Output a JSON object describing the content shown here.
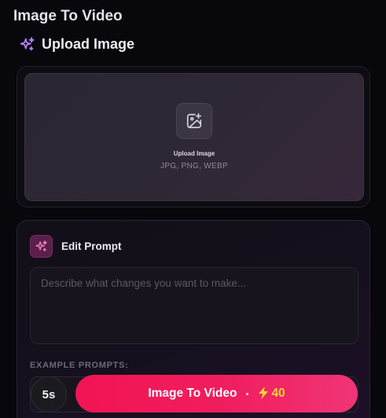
{
  "page": {
    "title": "Image To Video"
  },
  "upload_section": {
    "heading": "Upload Image",
    "heading_icon": "sparkles-icon",
    "dropzone": {
      "icon": "image-plus-icon",
      "title": "Upload Image",
      "formats": "JPG, PNG, WEBP"
    }
  },
  "prompt_section": {
    "heading": "Edit Prompt",
    "heading_icon": "sparkles-icon",
    "textarea": {
      "value": "",
      "placeholder": "Describe what changes you want to make..."
    },
    "examples_label": "EXAMPLE PROMPTS:",
    "examples": [
      {
        "text": ""
      }
    ]
  },
  "actions": {
    "duration": "5s",
    "generate_label": "Image To Video",
    "credits_icon": "lightning-icon",
    "credits": "40"
  },
  "colors": {
    "accent": "#f21454",
    "credits": "#ffd233",
    "sparkle": "#b57cf5",
    "background": "#08070b"
  }
}
